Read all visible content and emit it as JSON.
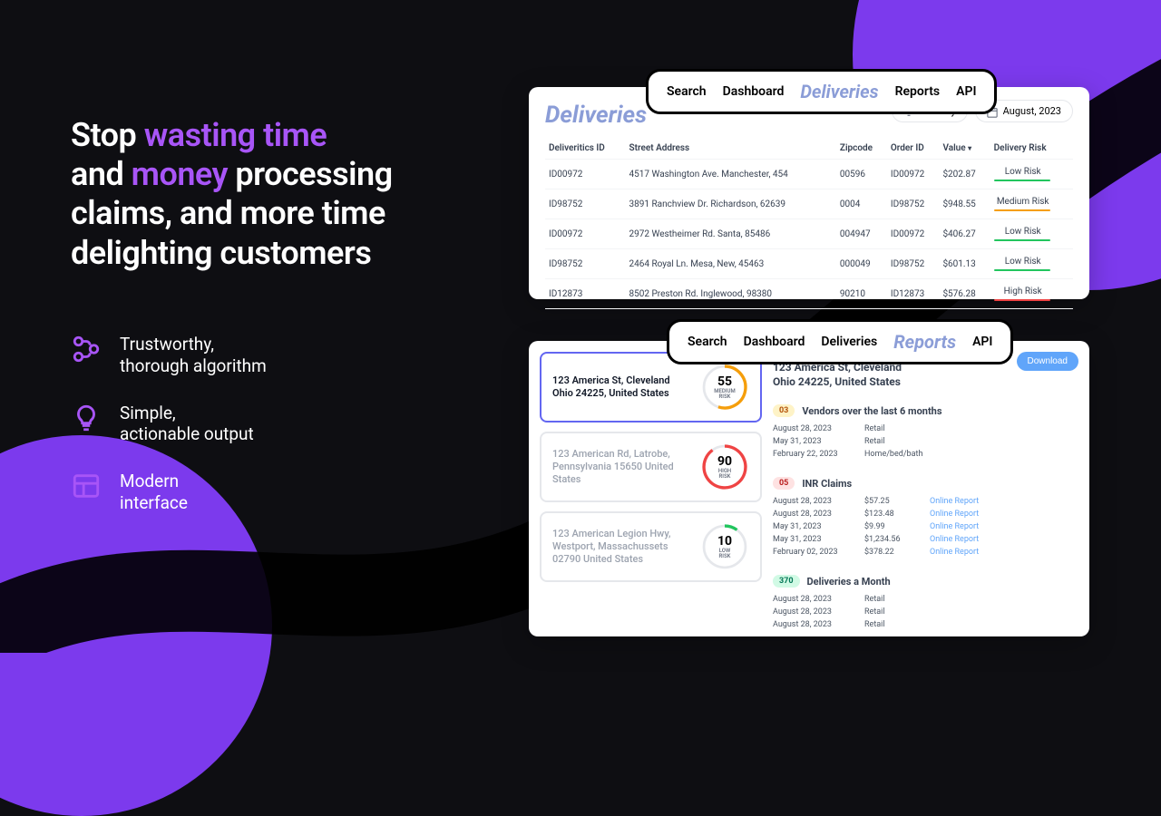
{
  "hero": {
    "line1a": "Stop ",
    "line1b": "wasting time",
    "line2a": "and ",
    "line2b": "money",
    "line2c": " processing",
    "line3": "claims, and more time",
    "line4": "delighting customers"
  },
  "features": [
    {
      "title": "Trustworthy,",
      "sub": "thorough algorithm"
    },
    {
      "title": "Simple,",
      "sub": "actionable output"
    },
    {
      "title": "Modern",
      "sub": "interface"
    }
  ],
  "nav": {
    "items": [
      "Search",
      "Dashboard",
      "Deliveries",
      "Reports",
      "API"
    ],
    "active1": "Deliveries",
    "active2": "Reports"
  },
  "deliveries": {
    "title": "Deliveries",
    "filter_by": "Filter By",
    "date_filter": "August, 2023",
    "columns": [
      "Deliveritics ID",
      "Street Address",
      "Zipcode",
      "Order ID",
      "Value",
      "Delivery Risk"
    ],
    "rows": [
      {
        "id": "ID00972",
        "addr": "4517 Washington Ave. Manchester, 454",
        "zip": "00596",
        "order": "ID00972",
        "value": "$202.87",
        "risk": "Low Risk",
        "level": "low"
      },
      {
        "id": "ID98752",
        "addr": "3891 Ranchview Dr. Richardson, 62639",
        "zip": "0004",
        "order": "ID98752",
        "value": "$948.55",
        "risk": "Medium Risk",
        "level": "med"
      },
      {
        "id": "ID00972",
        "addr": "2972 Westheimer Rd. Santa, 85486",
        "zip": "004947",
        "order": "ID00972",
        "value": "$406.27",
        "risk": "Low Risk",
        "level": "low"
      },
      {
        "id": "ID98752",
        "addr": "2464 Royal Ln. Mesa, New, 45463",
        "zip": "000049",
        "order": "ID98752",
        "value": "$601.13",
        "risk": "Low Risk",
        "level": "low"
      },
      {
        "id": "ID12873",
        "addr": "8502 Preston Rd. Inglewood, 98380",
        "zip": "90210",
        "order": "ID12873",
        "value": "$576.28",
        "risk": "High Risk",
        "level": "high"
      }
    ]
  },
  "reports": {
    "download": "Download",
    "addresses": [
      {
        "line": "123 America St, Cleveland Ohio 24225, United States",
        "score": "55",
        "label": "MEDIUM RISK",
        "selected": true
      },
      {
        "line": "123 American Rd, Latrobe, Pennsylvania 15650 United States",
        "score": "90",
        "label": "HIGH RISK",
        "selected": false
      },
      {
        "line": "123 American Legion Hwy, Westport, Massachussets 02790 United States",
        "score": "10",
        "label": "LOW RISK",
        "selected": false
      }
    ],
    "detail_title1": "123 America St, Cleveland",
    "detail_title2": "Ohio 24225, United States",
    "sections": {
      "vendors": {
        "badge": "03",
        "title": "Vendors over the last 6 months",
        "rows": [
          {
            "date": "August 28, 2023",
            "v": "Retail"
          },
          {
            "date": "May 31, 2023",
            "v": "Retail"
          },
          {
            "date": "February 22, 2023",
            "v": "Home/bed/bath"
          }
        ]
      },
      "inr": {
        "badge": "05",
        "title": "INR Claims",
        "rows": [
          {
            "date": "August 28, 2023",
            "amt": "$57.25",
            "src": "Online Report"
          },
          {
            "date": "August 28, 2023",
            "amt": "$123.48",
            "src": "Online Report"
          },
          {
            "date": "May 31, 2023",
            "amt": "$9.99",
            "src": "Online Report"
          },
          {
            "date": "May 31, 2023",
            "amt": "$1,234.56",
            "src": "Online Report"
          },
          {
            "date": "February 02, 2023",
            "amt": "$378.22",
            "src": "Online Report"
          }
        ]
      },
      "monthly": {
        "badge": "370",
        "title": "Deliveries a Month",
        "rows": [
          {
            "date": "August 28, 2023",
            "v": "Retail"
          },
          {
            "date": "August 28, 2023",
            "v": "Retail"
          },
          {
            "date": "August 28, 2023",
            "v": "Retail"
          }
        ]
      }
    }
  }
}
